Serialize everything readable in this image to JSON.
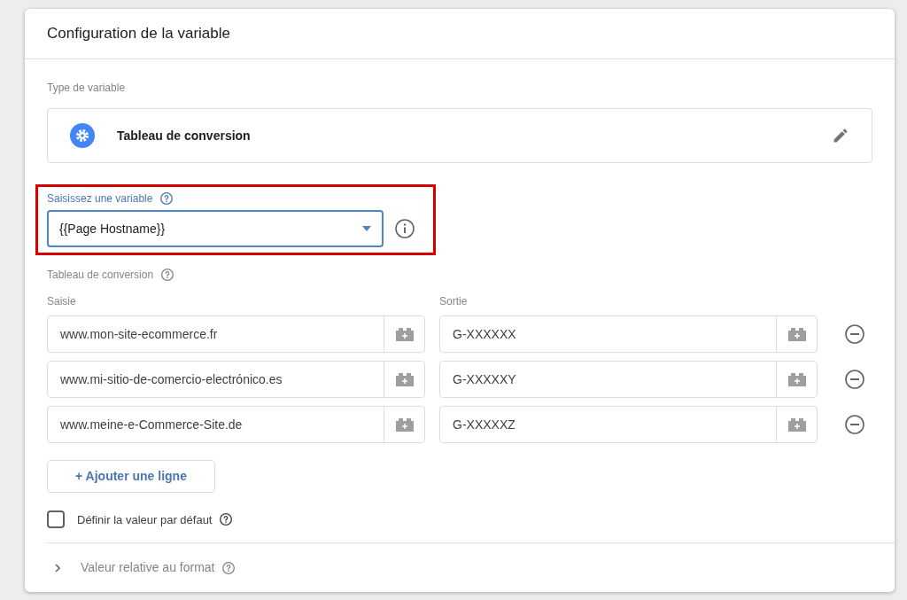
{
  "header": {
    "title": "Configuration de la variable"
  },
  "variable_type": {
    "label": "Type de variable",
    "name": "Tableau de conversion"
  },
  "input_variable": {
    "label": "Saisissez une variable",
    "value": "{{Page Hostname}}"
  },
  "table": {
    "label": "Tableau de conversion",
    "columns": [
      "Saisie",
      "Sortie"
    ],
    "rows": [
      {
        "input": "www.mon-site-ecommerce.fr",
        "output": "G-XXXXXX"
      },
      {
        "input": "www.mi-sitio-de-comercio-electrónico.es",
        "output": "G-XXXXXY"
      },
      {
        "input": "www.meine-e-Commerce-Site.de",
        "output": "G-XXXXXZ"
      }
    ]
  },
  "add_row_button": "+ Ajouter une ligne",
  "default_value": {
    "label": "Définir la valeur par défaut",
    "checked": false
  },
  "format_section": {
    "label": "Valeur relative au format",
    "expanded": false
  }
}
